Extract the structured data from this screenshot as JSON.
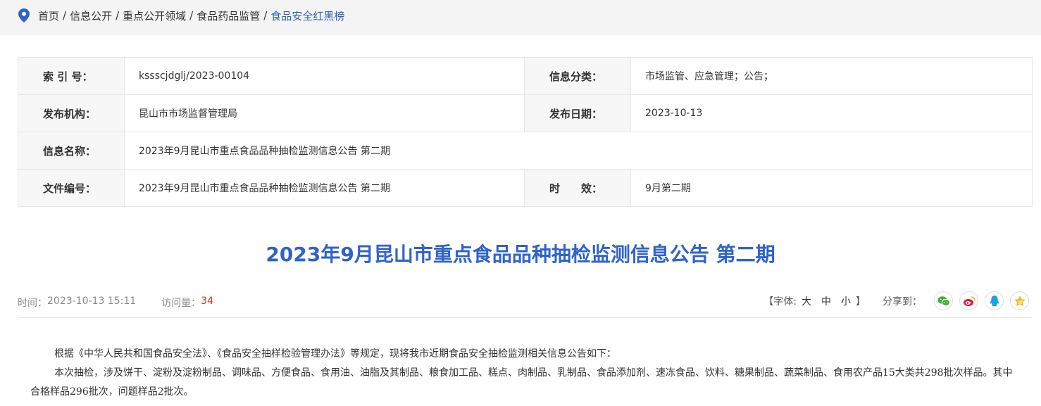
{
  "breadcrumb": {
    "items": [
      {
        "label": "首页"
      },
      {
        "label": "信息公开"
      },
      {
        "label": "重点公开领域"
      },
      {
        "label": "食品药品监管"
      },
      {
        "label": "食品安全红黑榜"
      }
    ],
    "separator": "/",
    "icon": "location-pin-icon"
  },
  "meta": {
    "index_label": "索 引 号：",
    "index_value": "ksssсjdglj/2023-00104",
    "category_label": "信息分类：",
    "category_value": "市场监管、应急管理；公告；",
    "publisher_label": "发布机构：",
    "publisher_value": "昆山市市场监督管理局",
    "date_label": "发布日期：",
    "date_value": "2023-10-13",
    "name_label": "信息名称：",
    "name_value": "2023年9月昆山市重点食品品种抽检监测信息公告 第二期",
    "docno_label": "文件编号：",
    "docno_value": "2023年9月昆山市重点食品品种抽检监测信息公告 第二期",
    "validity_label": "时　　效：",
    "validity_value": "9月第二期"
  },
  "article": {
    "title": "2023年9月昆山市重点食品品种抽检监测信息公告 第二期",
    "time_label": "时间：",
    "time_value": "2023-10-13 15:11",
    "views_label": "访问量：",
    "views_value": "34",
    "font_label": "【字体:",
    "font_large": "大",
    "font_medium": "中",
    "font_small": "小",
    "font_end": "】",
    "share_label": "分享到：",
    "share_icons": [
      "wechat-icon",
      "weibo-icon",
      "qq-icon",
      "qzone-icon"
    ],
    "share_colors": {
      "wechat": "#3cb034",
      "weibo": "#e6162d",
      "qq": "#1aa3e8",
      "qzone": "#f5b400"
    },
    "paragraphs": [
      "根据《中华人民共和国食品安全法》、《食品安全抽样检验管理办法》等规定，现将我市近期食品安全抽检监测相关信息公告如下：",
      "本次抽检，涉及饼干、淀粉及淀粉制品、调味品、方便食品、食用油、油脂及其制品、粮食加工品、糕点、肉制品、乳制品、食品添加剂、速冻食品、饮料、糖果制品、蔬菜制品、食用农产品15大类共298批次样品。其中合格样品296批次，问题样品2批次。"
    ]
  },
  "colors": {
    "accent": "#2f63c9",
    "views": "#c0392b"
  }
}
